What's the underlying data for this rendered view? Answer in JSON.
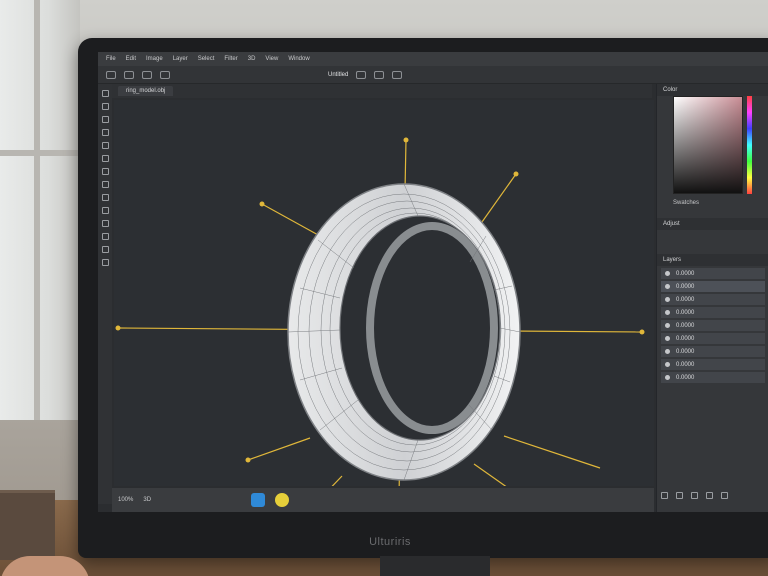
{
  "monitor_brand": "Ulturiris",
  "app": {
    "menu_items": [
      "File",
      "Edit",
      "Image",
      "Layer",
      "Select",
      "Filter",
      "3D",
      "View",
      "Window"
    ],
    "window_title": "Untitled",
    "document_tab": "ring_model.obj"
  },
  "panels": {
    "color_title": "Color",
    "swatches_label": "Swatches",
    "adjust_title": "Adjust",
    "layers_title": "Layers",
    "layers": [
      "0.0000",
      "0.0000",
      "0.0000",
      "0.0000",
      "0.0000",
      "0.0000",
      "0.0000",
      "0.0000",
      "0.0000"
    ]
  },
  "status": {
    "zoom": "100%",
    "doc_info": "3D"
  },
  "icons": [
    "search-icon",
    "move-icon",
    "eye-icon",
    "gear-icon"
  ],
  "colors": {
    "accent": "#e0b73a",
    "canvas": "#2c2f33",
    "task_blue": "#2f8ad8",
    "task_yellow": "#e6cf3a"
  }
}
